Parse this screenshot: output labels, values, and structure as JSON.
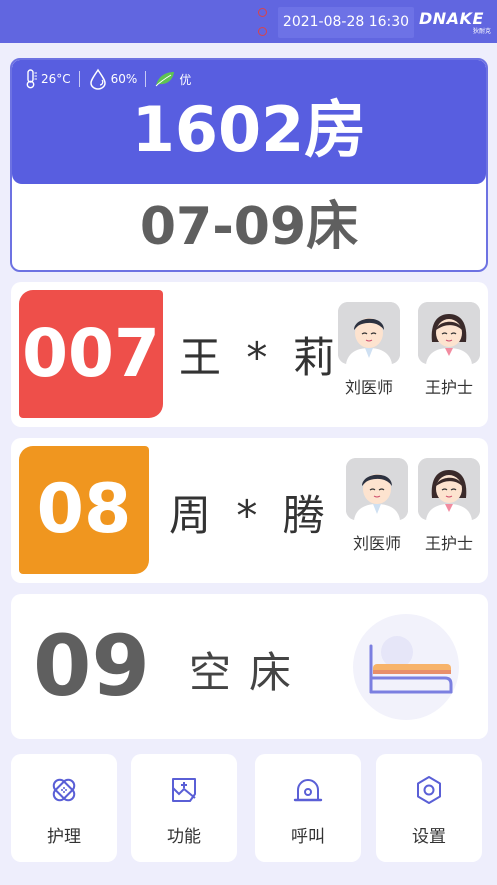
{
  "header": {
    "datetime": "2021-08-28 16:30",
    "brand": "DNAKE",
    "brand_sub": "狄耐克",
    "bg_color": "#6166e0"
  },
  "room": {
    "temperature": "26°C",
    "humidity": "60%",
    "air_quality": "优",
    "room_no": "1602房",
    "bed_range": "07-09床",
    "icons": [
      "thermometer-icon",
      "humidity-drop-icon",
      "leaf-icon"
    ]
  },
  "beds": [
    {
      "number": "007",
      "patient": "王 * 莉",
      "tag_color": "#ee4f4a",
      "doctor": "刘医师",
      "nurse": "王护士"
    },
    {
      "number": "08",
      "patient": "周 * 腾",
      "tag_color": "#f0961f",
      "doctor": "刘医师",
      "nurse": "王护士"
    },
    {
      "number": "09",
      "status": "空床",
      "icon": "empty-bed-icon"
    }
  ],
  "nav": [
    {
      "label": "护理",
      "icon": "bandage-icon"
    },
    {
      "label": "功能",
      "icon": "function-icon"
    },
    {
      "label": "呼叫",
      "icon": "call-bell-icon"
    },
    {
      "label": "设置",
      "icon": "settings-hexagon-icon"
    }
  ],
  "accent_color": "#585ee0"
}
